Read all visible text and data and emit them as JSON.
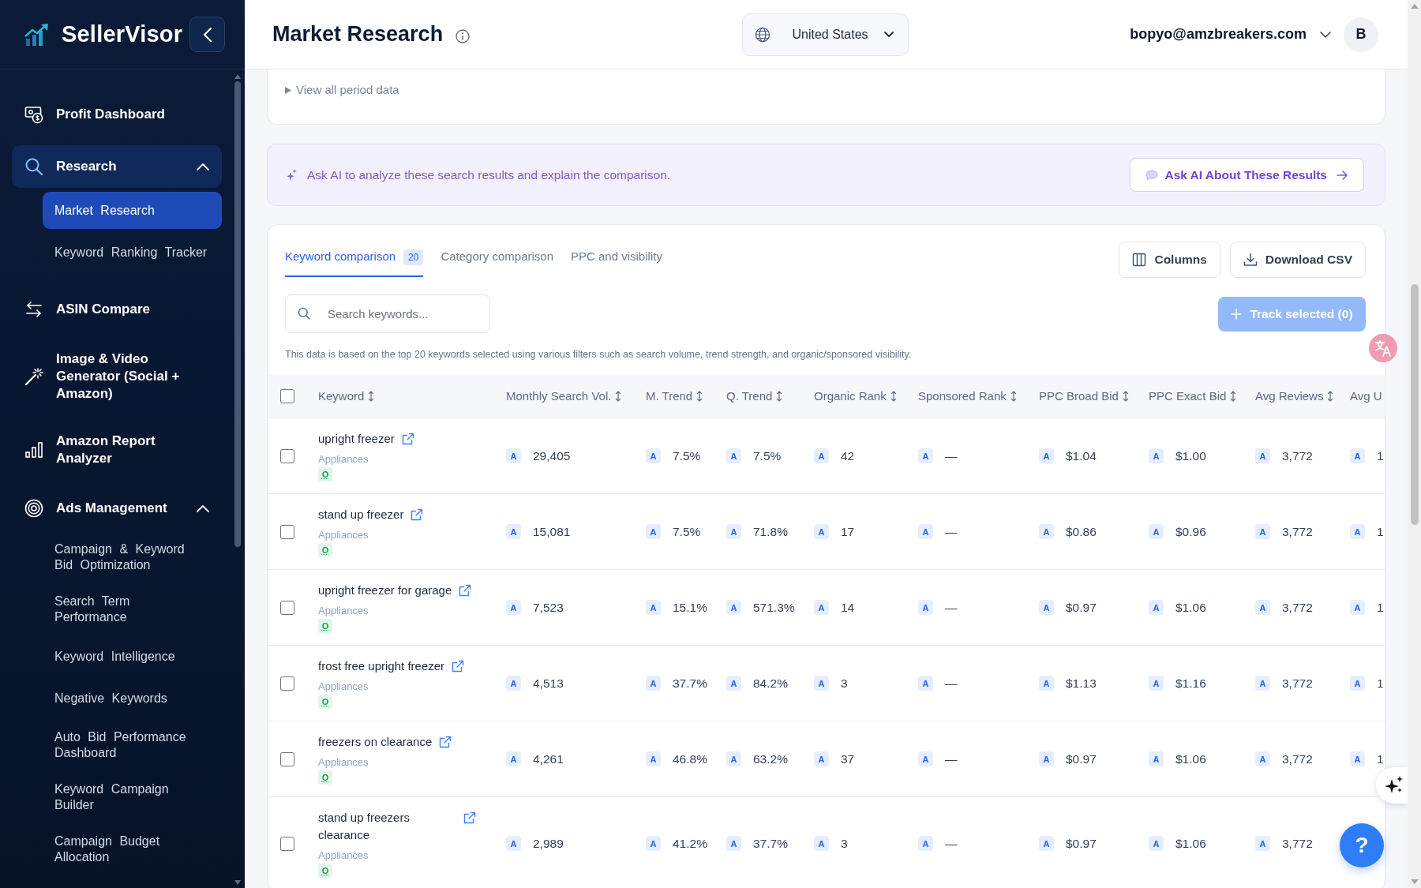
{
  "brand": {
    "name": "SellerVisor"
  },
  "sidebar": {
    "items": [
      {
        "label": "Profit Dashboard",
        "selected": false
      },
      {
        "label": "Research",
        "selected": true,
        "expanded": true,
        "children": [
          {
            "label": "Market Research",
            "selected": true
          },
          {
            "label": "Keyword Ranking Tracker",
            "selected": false
          }
        ]
      },
      {
        "label": "ASIN Compare",
        "selected": false
      },
      {
        "label": "Image & Video Generator (Social + Amazon)",
        "selected": false
      },
      {
        "label": "Amazon Report Analyzer",
        "selected": false
      },
      {
        "label": "Ads Management",
        "selected": false,
        "expanded": true,
        "children": [
          {
            "label": "Campaign & Keyword Bid Optimization",
            "selected": false
          },
          {
            "label": "Search Term Performance",
            "selected": false
          },
          {
            "label": "Keyword Intelligence",
            "selected": false
          },
          {
            "label": "Negative Keywords",
            "selected": false
          },
          {
            "label": "Auto Bid Performance Dashboard",
            "selected": false
          },
          {
            "label": "Keyword Campaign Builder",
            "selected": false
          },
          {
            "label": "Campaign Budget Allocation",
            "selected": false
          }
        ]
      }
    ]
  },
  "header": {
    "title": "Market Research",
    "country": "United States",
    "user_email": "bopyo@amzbreakers.com",
    "avatar_initial": "B"
  },
  "period_panel": {
    "toggle": "View all period data",
    "expanded": false
  },
  "ai_banner": {
    "text": "Ask AI to analyze these search results and explain the comparison.",
    "button": "Ask AI About These Results"
  },
  "results": {
    "tabs": [
      {
        "label": "Keyword comparison",
        "count": "20",
        "selected": true
      },
      {
        "label": "Category comparison",
        "selected": false
      },
      {
        "label": "PPC and visibility",
        "selected": false
      }
    ],
    "buttons": [
      "Columns",
      "Download CSV"
    ],
    "search": {
      "placeholder": "Search keywords..."
    },
    "track_button": {
      "label": "Track selected (0)",
      "disabled": true
    },
    "note": "This data is based on the top 20 keywords selected using various filters such as search volume, trend strength, and organic/sponsored visibility.",
    "table": {
      "select_all": {
        "checked": false
      },
      "columns": [
        "Keyword",
        "Monthly Search Vol.",
        "M. Trend",
        "Q. Trend",
        "Organic Rank",
        "Sponsored Rank",
        "PPC Broad Bid",
        "PPC Exact Bid",
        "Avg Reviews",
        "Avg U"
      ],
      "rows": [
        {
          "checked": false,
          "cells": [
            {
              "kind": "keyword",
              "text": "upright freezer",
              "category": "Appliances",
              "tag": "O"
            },
            {
              "kind": "metric",
              "badge": "A",
              "value": "29,405"
            },
            {
              "kind": "metric",
              "badge": "A",
              "value": "7.5%"
            },
            {
              "kind": "metric",
              "badge": "A",
              "value": "7.5%"
            },
            {
              "kind": "metric",
              "badge": "A",
              "value": "42"
            },
            {
              "kind": "metric",
              "badge": "A",
              "value": "—"
            },
            {
              "kind": "metric",
              "badge": "A",
              "value": "$1.04"
            },
            {
              "kind": "metric",
              "badge": "A",
              "value": "$1.00"
            },
            {
              "kind": "metric",
              "badge": "A",
              "value": "3,772"
            },
            {
              "kind": "metric",
              "badge": "A",
              "value": "1"
            }
          ]
        },
        {
          "checked": false,
          "cells": [
            {
              "kind": "keyword",
              "text": "stand up freezer",
              "category": "Appliances",
              "tag": "O"
            },
            {
              "kind": "metric",
              "badge": "A",
              "value": "15,081"
            },
            {
              "kind": "metric",
              "badge": "A",
              "value": "7.5%"
            },
            {
              "kind": "metric",
              "badge": "A",
              "value": "71.8%"
            },
            {
              "kind": "metric",
              "badge": "A",
              "value": "17"
            },
            {
              "kind": "metric",
              "badge": "A",
              "value": "—"
            },
            {
              "kind": "metric",
              "badge": "A",
              "value": "$0.86"
            },
            {
              "kind": "metric",
              "badge": "A",
              "value": "$0.96"
            },
            {
              "kind": "metric",
              "badge": "A",
              "value": "3,772"
            },
            {
              "kind": "metric",
              "badge": "A",
              "value": "1"
            }
          ]
        },
        {
          "checked": false,
          "cells": [
            {
              "kind": "keyword",
              "text": "upright freezer for garage",
              "category": "Appliances",
              "tag": "O"
            },
            {
              "kind": "metric",
              "badge": "A",
              "value": "7,523"
            },
            {
              "kind": "metric",
              "badge": "A",
              "value": "15.1%"
            },
            {
              "kind": "metric",
              "badge": "A",
              "value": "571.3%"
            },
            {
              "kind": "metric",
              "badge": "A",
              "value": "14"
            },
            {
              "kind": "metric",
              "badge": "A",
              "value": "—"
            },
            {
              "kind": "metric",
              "badge": "A",
              "value": "$0.97"
            },
            {
              "kind": "metric",
              "badge": "A",
              "value": "$1.06"
            },
            {
              "kind": "metric",
              "badge": "A",
              "value": "3,772"
            },
            {
              "kind": "metric",
              "badge": "A",
              "value": "1"
            }
          ]
        },
        {
          "checked": false,
          "cells": [
            {
              "kind": "keyword",
              "text": "frost free upright freezer",
              "category": "Appliances",
              "tag": "O"
            },
            {
              "kind": "metric",
              "badge": "A",
              "value": "4,513"
            },
            {
              "kind": "metric",
              "badge": "A",
              "value": "37.7%"
            },
            {
              "kind": "metric",
              "badge": "A",
              "value": "84.2%"
            },
            {
              "kind": "metric",
              "badge": "A",
              "value": "3"
            },
            {
              "kind": "metric",
              "badge": "A",
              "value": "—"
            },
            {
              "kind": "metric",
              "badge": "A",
              "value": "$1.13"
            },
            {
              "kind": "metric",
              "badge": "A",
              "value": "$1.16"
            },
            {
              "kind": "metric",
              "badge": "A",
              "value": "3,772"
            },
            {
              "kind": "metric",
              "badge": "A",
              "value": "1"
            }
          ]
        },
        {
          "checked": false,
          "cells": [
            {
              "kind": "keyword",
              "text": "freezers on clearance",
              "category": "Appliances",
              "tag": "O"
            },
            {
              "kind": "metric",
              "badge": "A",
              "value": "4,261"
            },
            {
              "kind": "metric",
              "badge": "A",
              "value": "46.8%"
            },
            {
              "kind": "metric",
              "badge": "A",
              "value": "63.2%"
            },
            {
              "kind": "metric",
              "badge": "A",
              "value": "37"
            },
            {
              "kind": "metric",
              "badge": "A",
              "value": "—"
            },
            {
              "kind": "metric",
              "badge": "A",
              "value": "$0.97"
            },
            {
              "kind": "metric",
              "badge": "A",
              "value": "$1.06"
            },
            {
              "kind": "metric",
              "badge": "A",
              "value": "3,772"
            },
            {
              "kind": "metric",
              "badge": "A",
              "value": "1"
            }
          ]
        },
        {
          "checked": false,
          "cells": [
            {
              "kind": "keyword",
              "text": "stand up freezers clearance",
              "category": "Appliances",
              "tag": "O"
            },
            {
              "kind": "metric",
              "badge": "A",
              "value": "2,989"
            },
            {
              "kind": "metric",
              "badge": "A",
              "value": "41.2%"
            },
            {
              "kind": "metric",
              "badge": "A",
              "value": "37.7%"
            },
            {
              "kind": "metric",
              "badge": "A",
              "value": "3"
            },
            {
              "kind": "metric",
              "badge": "A",
              "value": "—"
            },
            {
              "kind": "metric",
              "badge": "A",
              "value": "$0.97"
            },
            {
              "kind": "metric",
              "badge": "A",
              "value": "$1.06"
            },
            {
              "kind": "metric",
              "badge": "A",
              "value": "3,772"
            }
          ]
        }
      ]
    }
  },
  "help_button": {
    "label": "?"
  }
}
